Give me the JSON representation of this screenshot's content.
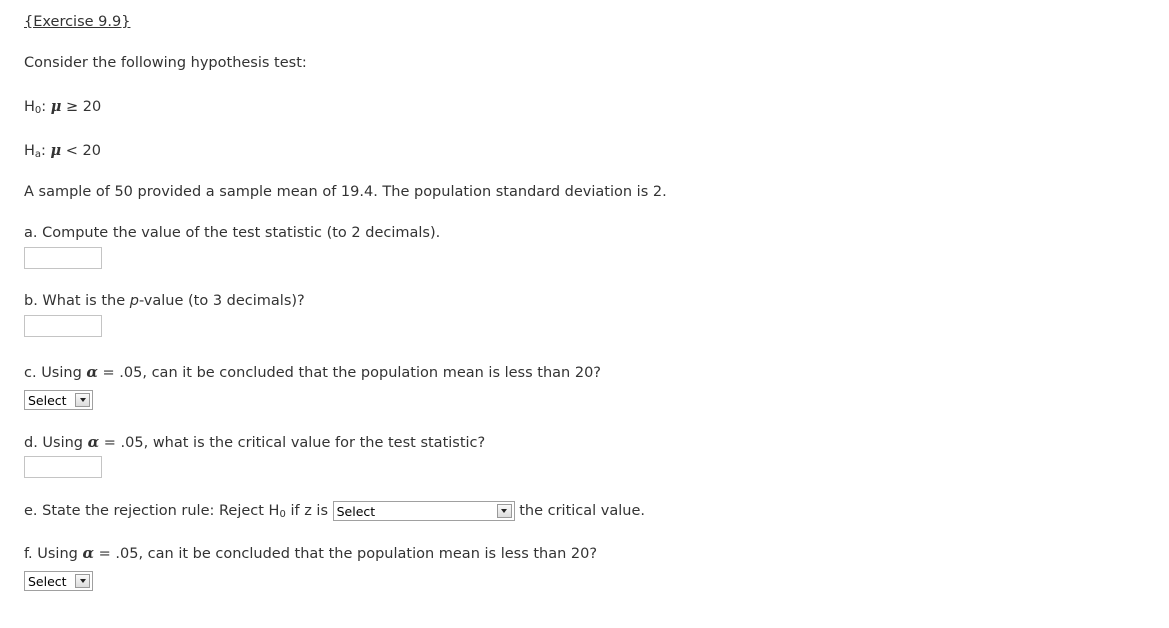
{
  "title": "{Exercise 9.9}",
  "intro": "Consider the following hypothesis test:",
  "h0": {
    "label": "H",
    "sub": "0",
    "sep": ": ",
    "symbol": "μ",
    "rel": " ≥ 20"
  },
  "ha": {
    "label": "H",
    "sub": "a",
    "sep": ": ",
    "symbol": "μ",
    "rel": " < 20"
  },
  "sample_text": "A sample of 50 provided a sample mean of 19.4. The population standard deviation is 2.",
  "questions": {
    "a": {
      "text": "a. Compute the value of the test statistic (to 2 decimals).",
      "value": ""
    },
    "b": {
      "pre": "b. What is the ",
      "italic": "p",
      "post": "-value (to 3 decimals)?",
      "value": ""
    },
    "c": {
      "pre": "c. Using ",
      "alpha": "α",
      "post": " = .05, can it be concluded that the population mean is less than 20?",
      "select": "Select"
    },
    "d": {
      "pre": "d. Using ",
      "alpha": "α",
      "post": " = .05, what is the critical value for the test statistic?",
      "value": ""
    },
    "e": {
      "pre": "e. State the rejection rule: Reject H",
      "sub": "0",
      "mid": " if z is ",
      "select": "Select",
      "post": " the critical value."
    },
    "f": {
      "pre": "f. Using ",
      "alpha": "α",
      "post": " = .05, can it be concluded that the population mean is less than 20?",
      "select": "Select"
    }
  }
}
